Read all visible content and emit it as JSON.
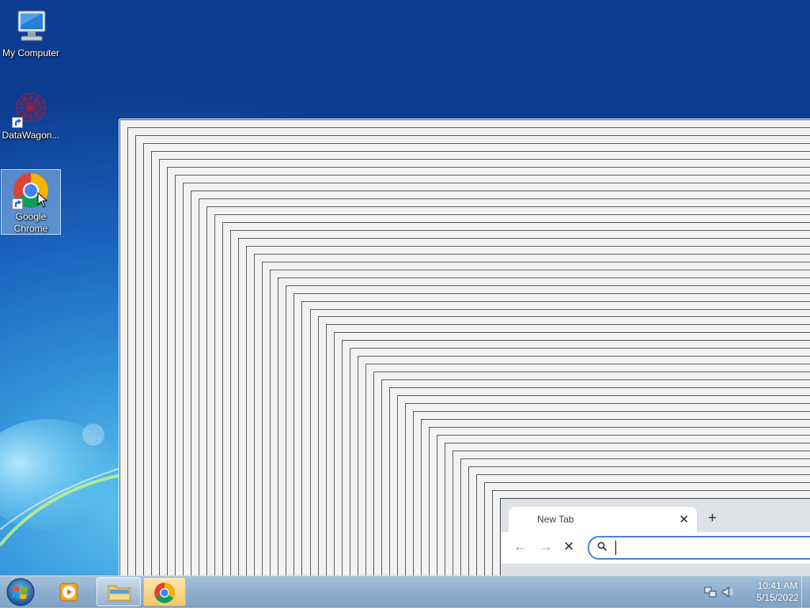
{
  "desktop": {
    "icons": [
      {
        "label": "My Computer",
        "icon": "computer-icon"
      },
      {
        "label": "DataWagon...",
        "icon": "datawagon-icon"
      },
      {
        "label": "Google Chrome",
        "icon": "chrome-icon",
        "selected": true
      }
    ]
  },
  "browser": {
    "tab_title": "New Tab",
    "tab_close": "✕",
    "new_tab": "+",
    "back": "←",
    "forward": "→",
    "stop": "✕",
    "omnibox_value": "",
    "search_icon": "search-icon"
  },
  "taskbar": {
    "items": [
      {
        "name": "windows-media-player",
        "icon": "media-player-icon"
      },
      {
        "name": "windows-explorer",
        "icon": "folder-icon"
      },
      {
        "name": "google-chrome",
        "icon": "chrome-icon",
        "active": true
      }
    ],
    "clock": {
      "time": "10:41 AM",
      "date": "5/15/2022"
    },
    "tray_icons": [
      "network-icon",
      "volume-icon"
    ]
  },
  "colors": {
    "desktop_blue": "#1a63bd",
    "taskbar": "#8fb0cf",
    "omnibox_border": "#4a80d9",
    "active_task": "#f5c766"
  }
}
